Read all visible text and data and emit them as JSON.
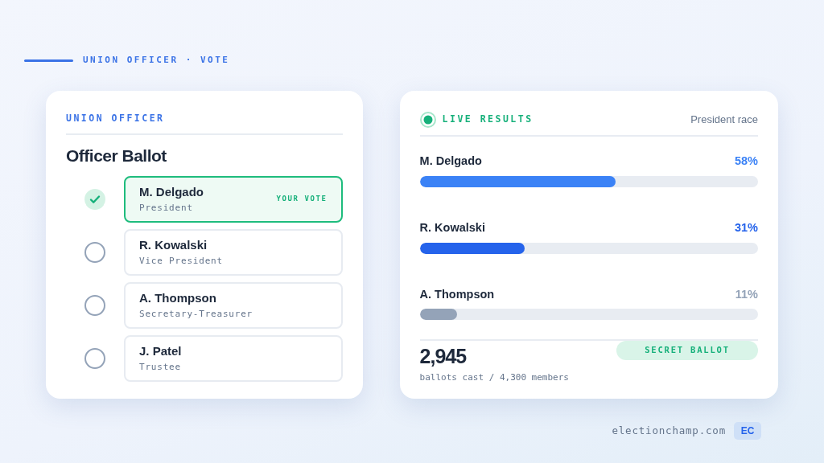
{
  "header": {
    "title": "UNION OFFICER · VOTE"
  },
  "ballot": {
    "eyebrow": "UNION OFFICER",
    "title": "Officer Ballot",
    "candidates": [
      {
        "name": "M. Delgado",
        "role": "President",
        "selected": true,
        "tag": "YOUR VOTE"
      },
      {
        "name": "R. Kowalski",
        "role": "Vice President",
        "selected": false
      },
      {
        "name": "A. Thompson",
        "role": "Secretary-Treasurer",
        "selected": false
      },
      {
        "name": "J. Patel",
        "role": "Trustee",
        "selected": false
      }
    ]
  },
  "results": {
    "title": "LIVE RESULTS",
    "race": "President race",
    "rows": [
      {
        "name": "M. Delgado",
        "percent": "58%",
        "level": 0.58,
        "color": "#3b82f6"
      },
      {
        "name": "R. Kowalski",
        "percent": "31%",
        "level": 0.31,
        "color": "#2563eb"
      },
      {
        "name": "A. Thompson",
        "percent": "11%",
        "level": 0.11,
        "color": "#94a3b8"
      }
    ],
    "total": "2,945",
    "total_caption": "ballots cast / 4,300 members",
    "badge": "SECRET BALLOT"
  },
  "footer": {
    "site": "electionchamp.com",
    "logo": "EC"
  }
}
